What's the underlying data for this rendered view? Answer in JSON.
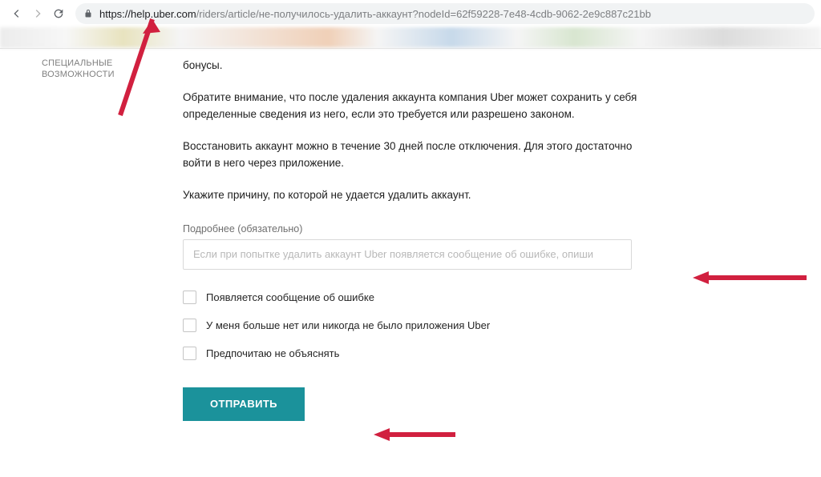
{
  "browser": {
    "url_host": "https://help.uber.com",
    "url_path": "/riders/article/не-получилось-удалить-аккаунт?nodeId=62f59228-7e48-4cdb-9062-2e9c887c21bb"
  },
  "sidebar": {
    "accessibility_label_1": "СПЕЦИАЛЬНЫЕ",
    "accessibility_label_2": "ВОЗМОЖНОСТИ"
  },
  "article": {
    "p0": "бонусы.",
    "p1": "Обратите внимание, что после удаления аккаунта компания Uber может сохранить у себя определенные сведения из него, если это требуется или разрешено законом.",
    "p2": "Восстановить аккаунт можно в течение 30 дней после отключения. Для этого достаточно войти в него через приложение.",
    "p3": "Укажите причину, по которой не удается удалить аккаунт.",
    "form": {
      "details_label": "Подробнее (обязательно)",
      "details_placeholder": "Если при попытке удалить аккаунт Uber появляется сообщение об ошибке, опиши",
      "opt_error": "Появляется сообщение об ошибке",
      "opt_noapp": "У меня больше нет или никогда не было приложения Uber",
      "opt_noexplain": "Предпочитаю не объяснять",
      "submit_label": "ОТПРАВИТЬ"
    }
  },
  "colors": {
    "accent": "#1b929b",
    "arrow": "#d1203f"
  }
}
